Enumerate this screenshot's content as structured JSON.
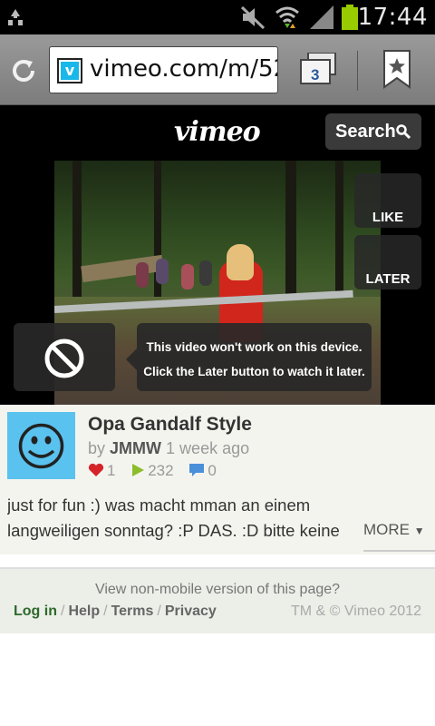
{
  "statusbar": {
    "time": "17:44",
    "icons": [
      "recycle-icon",
      "mute-icon",
      "wifi-icon",
      "signal-icon",
      "battery-icon"
    ],
    "battery_color": "#99cc00"
  },
  "browser": {
    "url": "vimeo.com/m/52",
    "tab_count": "3",
    "icons": [
      "refresh-icon",
      "tabs-icon",
      "bookmark-icon"
    ]
  },
  "header": {
    "logo": "vimeo",
    "search_label": "Search"
  },
  "player": {
    "like_label": "LIKE",
    "later_label": "LATER",
    "message_line1": "This video won't work on this device.",
    "message_line2": "Click the Later button to watch it later."
  },
  "video": {
    "title": "Opa Gandalf Style",
    "by": "by",
    "author": "JMMW",
    "age": "1 week ago",
    "likes": "1",
    "plays": "232",
    "comments": "0",
    "description": "just for fun :) was macht mman an einem langweiligen sonntag? :P DAS. :D bitte keine",
    "more_label": "MORE"
  },
  "footer": {
    "nonmobile": "View non-mobile version of this page?",
    "login": "Log in",
    "help": "Help",
    "terms": "Terms",
    "privacy": "Privacy",
    "separator": "/",
    "copyright": "TM & © Vimeo 2012"
  },
  "colors": {
    "accent": "#1ab7ea",
    "like_red": "#d6232a",
    "play_green": "#8bbd2b",
    "comment_blue": "#4a90d9",
    "login_green": "#2d6a2a"
  }
}
